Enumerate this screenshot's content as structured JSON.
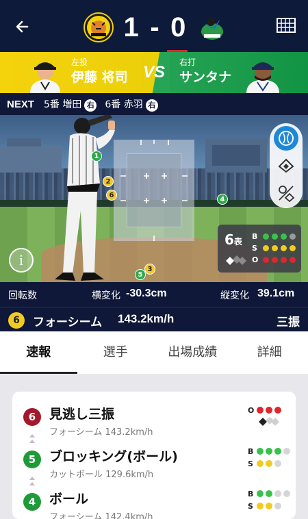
{
  "header": {
    "home_team": "Tigers",
    "away_team": "Swallows",
    "home_score": "1",
    "separator": "-",
    "away_score": "0",
    "colors": {
      "bg": "#0e1a3a",
      "accent": "#d5282e"
    }
  },
  "matchup": {
    "pitcher_role": "左投",
    "pitcher_name": "伊藤 将司",
    "vs": "VS",
    "batter_role": "右打",
    "batter_name": "サンタナ"
  },
  "next_bar": {
    "label": "NEXT",
    "batters": [
      {
        "order": "5番 増田",
        "hand": "右"
      },
      {
        "order": "6番 赤羽",
        "hand": "右"
      }
    ]
  },
  "field": {
    "pitch_markers": [
      {
        "label": "1",
        "color": "green"
      },
      {
        "label": "2",
        "color": "yellow"
      },
      {
        "label": "6",
        "color": "yellow"
      },
      {
        "label": "4",
        "color": "green"
      },
      {
        "label": "3",
        "color": "yellow"
      },
      {
        "label": "5",
        "color": "green"
      }
    ],
    "controls": [
      "ball-icon",
      "field-icon",
      "split-icon"
    ],
    "inning": "6",
    "inning_half": "表",
    "count": {
      "balls": 3,
      "strikes": 2,
      "outs": 3
    },
    "count_labels": {
      "b": "B",
      "s": "S",
      "o": "O"
    }
  },
  "pitch_stats": {
    "spin_label": "回転数",
    "hbreak_label": "横変化",
    "hbreak_value": "-30.3cm",
    "vbreak_label": "縦変化",
    "vbreak_value": "39.1cm"
  },
  "current_pitch": {
    "number": "6",
    "type": "フォーシーム",
    "speed": "143.2km/h",
    "result": "三振"
  },
  "tabs": [
    {
      "label": "速報",
      "active": true
    },
    {
      "label": "選手",
      "active": false
    },
    {
      "label": "出場成績",
      "active": false
    },
    {
      "label": "詳細",
      "active": false
    }
  ],
  "events": [
    {
      "number": "6",
      "title": "見逃し三振",
      "sub": "フォーシーム 143.2km/h",
      "badge_color": "#a4182e",
      "count_type": "out",
      "count_label": "O",
      "count_value": 3
    },
    {
      "number": "5",
      "title": "ブロッキング(ボール)",
      "sub": "カットボール 129.6km/h",
      "badge_color": "#1f9a3a",
      "count_type": "bs",
      "balls": 3,
      "strikes": 2
    },
    {
      "number": "4",
      "title": "ボール",
      "sub": "フォーシーム 142.4km/h",
      "badge_color": "#1f9a3a",
      "count_type": "bs",
      "balls": 2,
      "strikes": 2
    }
  ]
}
